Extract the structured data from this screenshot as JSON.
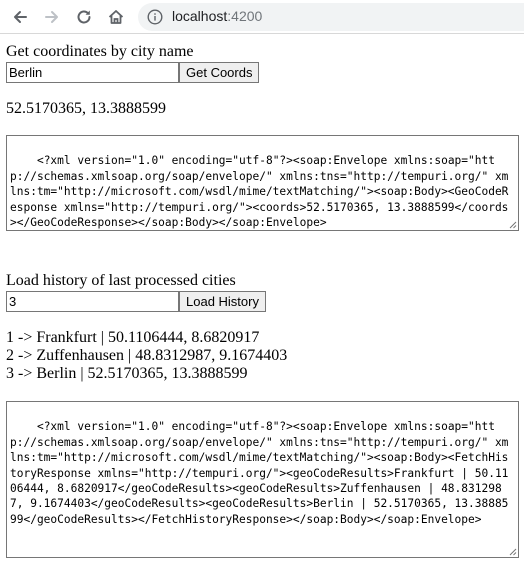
{
  "browser": {
    "url_host": "localhost",
    "url_port": ":4200",
    "icons": [
      "back-arrow-icon",
      "forward-arrow-icon",
      "reload-icon",
      "home-icon",
      "info-icon"
    ]
  },
  "coords_section": {
    "label": "Get coordinates by city name",
    "input_value": "Berlin",
    "button_label": "Get Coords",
    "result": "52.5170365, 13.3888599",
    "soap_response": "<?xml version=\"1.0\" encoding=\"utf-8\"?><soap:Envelope xmlns:soap=\"http://schemas.xmlsoap.org/soap/envelope/\" xmlns:tns=\"http://tempuri.org/\" xmlns:tm=\"http://microsoft.com/wsdl/mime/textMatching/\"><soap:Body><GeoCodeResponse xmlns=\"http://tempuri.org/\"><coords>52.5170365, 13.3888599</coords></GeoCodeResponse></soap:Body></soap:Envelope>"
  },
  "history_section": {
    "label": "Load history of last processed cities",
    "input_value": "3",
    "button_label": "Load History",
    "results": [
      "1 -> Frankfurt | 50.1106444, 8.6820917",
      "2 -> Zuffenhausen | 48.8312987, 9.1674403",
      "3 -> Berlin | 52.5170365, 13.3888599"
    ],
    "soap_response": "<?xml version=\"1.0\" encoding=\"utf-8\"?><soap:Envelope xmlns:soap=\"http://schemas.xmlsoap.org/soap/envelope/\" xmlns:tns=\"http://tempuri.org/\" xmlns:tm=\"http://microsoft.com/wsdl/mime/textMatching/\"><soap:Body><FetchHistoryResponse xmlns=\"http://tempuri.org/\"><geoCodeResults>Frankfurt | 50.1106444, 8.6820917</geoCodeResults><geoCodeResults>Zuffenhausen | 48.8312987, 9.1674403</geoCodeResults><geoCodeResults>Berlin | 52.5170365, 13.3888599</geoCodeResults></FetchHistoryResponse></soap:Body></soap:Envelope>"
  }
}
